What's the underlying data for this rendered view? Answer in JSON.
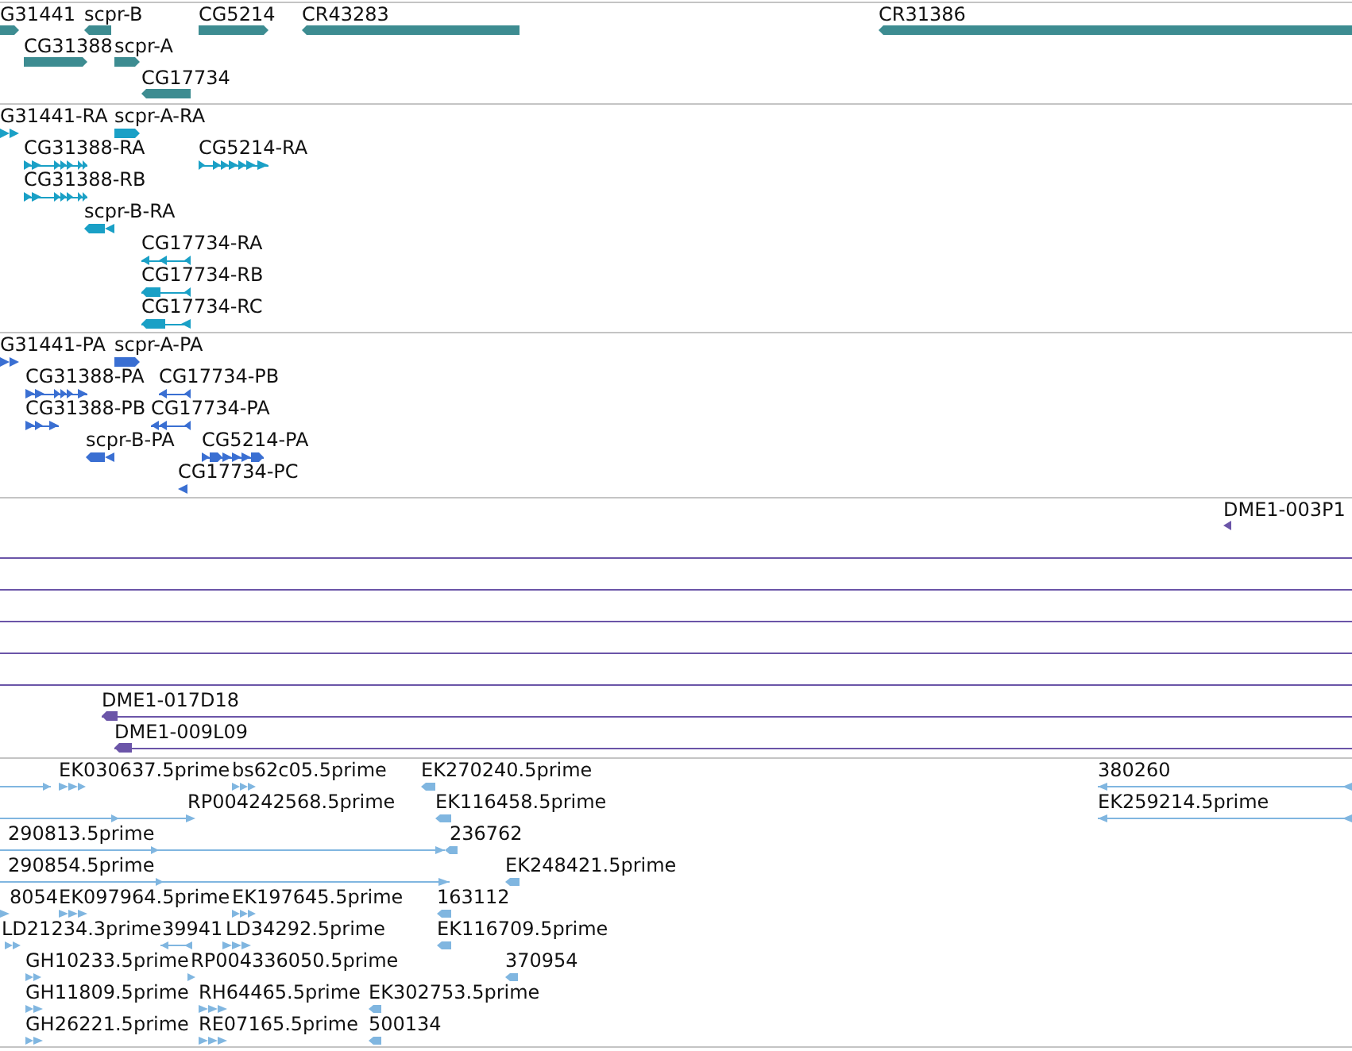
{
  "tracks": [
    {
      "kind": "gene",
      "features": [
        {
          "label": "G31441",
          "reverse": false
        },
        {
          "label": "scpr-B",
          "reverse": true
        },
        {
          "label": "CG5214",
          "reverse": false
        },
        {
          "label": "CR43283",
          "reverse": true
        },
        {
          "label": "CR31386",
          "reverse": true
        },
        {
          "label": "CG31388",
          "reverse": false
        },
        {
          "label": "scpr-A",
          "reverse": false
        },
        {
          "label": "CG17734",
          "reverse": true
        }
      ]
    },
    {
      "kind": "transcript",
      "features": [
        {
          "label": "G31441-RA",
          "reverse": false
        },
        {
          "label": "scpr-A-RA",
          "reverse": false
        },
        {
          "label": "CG31388-RA",
          "reverse": false
        },
        {
          "label": "CG5214-RA",
          "reverse": false
        },
        {
          "label": "CG31388-RB",
          "reverse": false
        },
        {
          "label": "scpr-B-RA",
          "reverse": true
        },
        {
          "label": "CG17734-RA",
          "reverse": true
        },
        {
          "label": "CG17734-RB",
          "reverse": true
        },
        {
          "label": "CG17734-RC",
          "reverse": true
        }
      ]
    },
    {
      "kind": "protein",
      "features": [
        {
          "label": "G31441-PA",
          "reverse": false
        },
        {
          "label": "scpr-A-PA",
          "reverse": false
        },
        {
          "label": "CG31388-PA",
          "reverse": false
        },
        {
          "label": "CG17734-PB",
          "reverse": true
        },
        {
          "label": "CG31388-PB",
          "reverse": false
        },
        {
          "label": "CG17734-PA",
          "reverse": true
        },
        {
          "label": "scpr-B-PA",
          "reverse": true
        },
        {
          "label": "CG5214-PA",
          "reverse": false
        },
        {
          "label": "CG17734-PC",
          "reverse": true
        }
      ]
    },
    {
      "kind": "clone",
      "features": [
        {
          "kind": "clone",
          "label": "DME1-003P1",
          "reverse": true
        },
        {
          "kind": "span"
        },
        {
          "kind": "span"
        },
        {
          "kind": "span"
        },
        {
          "kind": "span"
        },
        {
          "kind": "span"
        },
        {
          "kind": "clone",
          "label": "DME1-017D18",
          "reverse": true
        },
        {
          "kind": "clone",
          "label": "DME1-009L09",
          "reverse": true
        }
      ]
    },
    {
      "kind": "est",
      "features": [
        {
          "reverse": false
        },
        {
          "label": "EK030637.5prime",
          "reverse": false
        },
        {
          "label": "bs62c05.5prime",
          "reverse": false
        },
        {
          "label": "EK270240.5prime",
          "reverse": true
        },
        {
          "label": "380260",
          "reverse": true
        },
        {
          "reverse": false
        },
        {
          "label": "RP004242568.5prime",
          "reverse": false
        },
        {
          "label": "EK116458.5prime",
          "reverse": true
        },
        {
          "label": "EK259214.5prime",
          "reverse": true
        },
        {
          "label": "290813.5prime",
          "reverse": false
        },
        {
          "label": "236762",
          "reverse": true
        },
        {
          "label": "290854.5prime",
          "reverse": false
        },
        {
          "label": "EK248421.5prime",
          "reverse": true
        },
        {
          "label": "8054",
          "reverse": false
        },
        {
          "label": "EK097964.5prime",
          "reverse": false
        },
        {
          "label": "EK197645.5prime",
          "reverse": false
        },
        {
          "label": "163112",
          "reverse": true
        },
        {
          "label": "LD21234.3prime",
          "reverse": false
        },
        {
          "label": "39941",
          "reverse": true
        },
        {
          "label": "LD34292.5prime",
          "reverse": false
        },
        {
          "label": "EK116709.5prime",
          "reverse": true
        },
        {
          "label": "GH10233.5prime",
          "reverse": false
        },
        {
          "label": "RP004336050.5prime",
          "reverse": false
        },
        {
          "label": "370954",
          "reverse": true
        },
        {
          "label": "GH11809.5prime",
          "reverse": false
        },
        {
          "label": "RH64465.5prime",
          "reverse": false
        },
        {
          "label": "EK302753.5prime",
          "reverse": true
        },
        {
          "label": "GH26221.5prime",
          "reverse": false
        },
        {
          "label": "RE07165.5prime",
          "reverse": false
        },
        {
          "label": "500134",
          "reverse": true
        }
      ]
    }
  ]
}
